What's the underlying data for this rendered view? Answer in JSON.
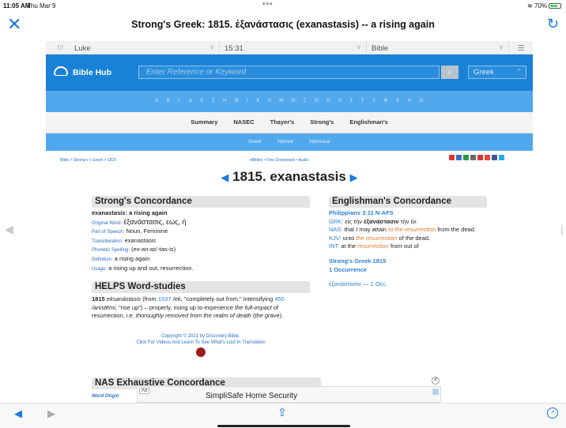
{
  "status": {
    "time": "11:05 AM",
    "date": "Thu Mar 9",
    "battery": "70%"
  },
  "nav": {
    "title": "Strong's Greek: 1815. ἐξανάστασις (exanastasis) -- a rising again"
  },
  "selectors": {
    "book": "Luke",
    "chapter": "15:31",
    "version": "Bible"
  },
  "hub": {
    "brand": "Bible Hub",
    "search_placeholder": "Enter Reference or Keyword",
    "lang": "Greek"
  },
  "greek_letters": [
    "Α",
    "Β",
    "Γ",
    "Δ",
    "Ε",
    "Ζ",
    "Η",
    "Θ",
    "Ι",
    "Κ",
    "Λ",
    "Μ",
    "Ν",
    "Ξ",
    "Ο",
    "Π",
    "Ρ",
    "Σ",
    "Τ",
    "Υ",
    "Φ",
    "Χ",
    "Ψ",
    "Ω"
  ],
  "tabs": [
    "Summary",
    "NASEC",
    "Thayer's",
    "Strong's",
    "Englishman's"
  ],
  "subtabs": [
    "Greek",
    "Hebrew",
    "Interlinear"
  ],
  "breadcrumb": "Bible > Strong's > Greek > 1815",
  "mid_links": "eBibles • Free Downloads • Audio",
  "heading": "1815. exanastasis",
  "strongs": {
    "header": "Strong's Concordance",
    "def_title": "exanastasis: a rising again",
    "original_label": "Original Word:",
    "original": "ἐξανάστασις, εως, ἡ",
    "pos_label": "Part of Speech:",
    "pos": "Noun, Feminine",
    "translit_label": "Transliteration:",
    "translit": "exanastasis",
    "phonetic_label": "Phonetic Spelling:",
    "phonetic": "(ex-an-as'-tas-is)",
    "definition_label": "Definition:",
    "definition": "a rising again",
    "usage_label": "Usage:",
    "usage": "a rising up and out, resurrection."
  },
  "helps": {
    "header": "HELPS Word-studies",
    "num": "1815",
    "word": "eksanástasis",
    "t1": " (from ",
    "ref1": "1537",
    "ref1_word": " /ek",
    "t2": ", \"completely out from,\" intensifying ",
    "ref2": "450",
    "ref2_word": "/anistēmi",
    "t3": ", \"rise up\") – properly, rising up to experience ",
    "em1": "the full-impact",
    "t4": " of resurrection, i.e. ",
    "em2": "thoroughly removed from the realm of death",
    "t5": " (",
    "em3": "the grave",
    "t6": ")."
  },
  "copyright": {
    "line1": "Copyright © 2021 by Discovery Bible.",
    "line2": "Click For Videos And Learn To See What's Lost In Translation"
  },
  "englishman": {
    "header": "Englishman's Concordance",
    "verse": "Philippians 3:11 N-AFS",
    "grk_label": "GRK:",
    "grk_pre": " εἰς τὴν ",
    "grk_word": "ἐξανάστασιν",
    "grk_post": " τὴν ἐκ",
    "nas_label": "NAS:",
    "nas_pre": " that I may attain ",
    "nas_em": "to the resurrection",
    "nas_post": " from the dead.",
    "kjv_label": "KJV:",
    "kjv_pre": " unto ",
    "kjv_em": "the resurrection",
    "kjv_post": " of the dead.",
    "int_label": "INT:",
    "int_pre": " at the ",
    "int_em": "resurrection",
    "int_post": " from out of",
    "strongs_link": "Strong's Greek 1815",
    "occurrence": "1 Occurrence",
    "occ_word": "ἐξανάστασιν — 1 Occ."
  },
  "nas": {
    "header": "NAS Exhaustive Concordance",
    "word_origin": "Word Origin"
  },
  "ad": {
    "tag": "Ad",
    "title": "SimpliSafe Home Security"
  }
}
